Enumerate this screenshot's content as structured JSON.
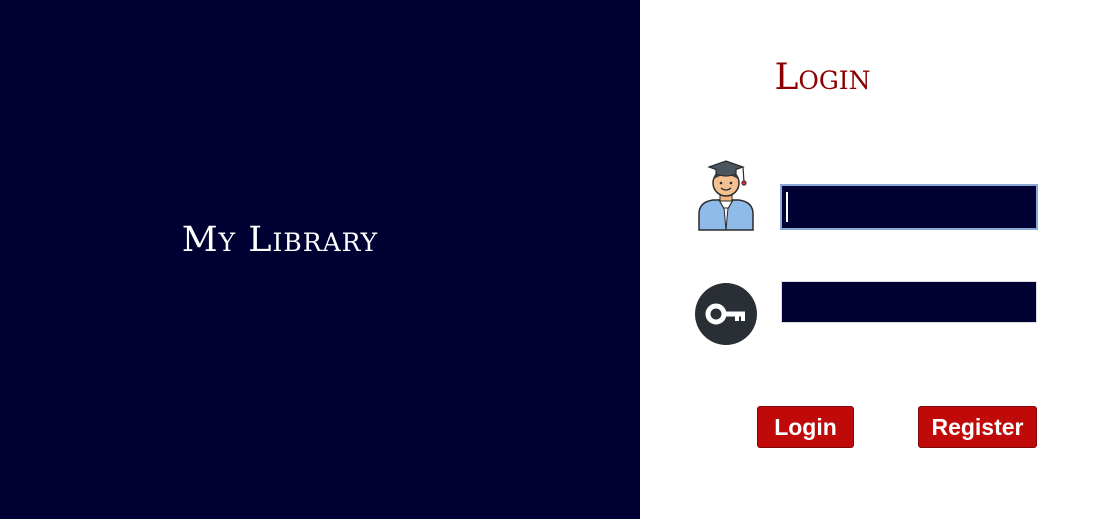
{
  "brand": {
    "title": "My Library",
    "panel_color": "#000033"
  },
  "login_form": {
    "title": "Login",
    "title_color": "#8b0000",
    "username": {
      "icon": "student-avatar-icon",
      "value": "",
      "placeholder": ""
    },
    "password": {
      "icon": "key-icon",
      "value": "",
      "placeholder": ""
    },
    "buttons": {
      "login_label": "Login",
      "register_label": "Register",
      "color": "#c00a0a"
    }
  }
}
